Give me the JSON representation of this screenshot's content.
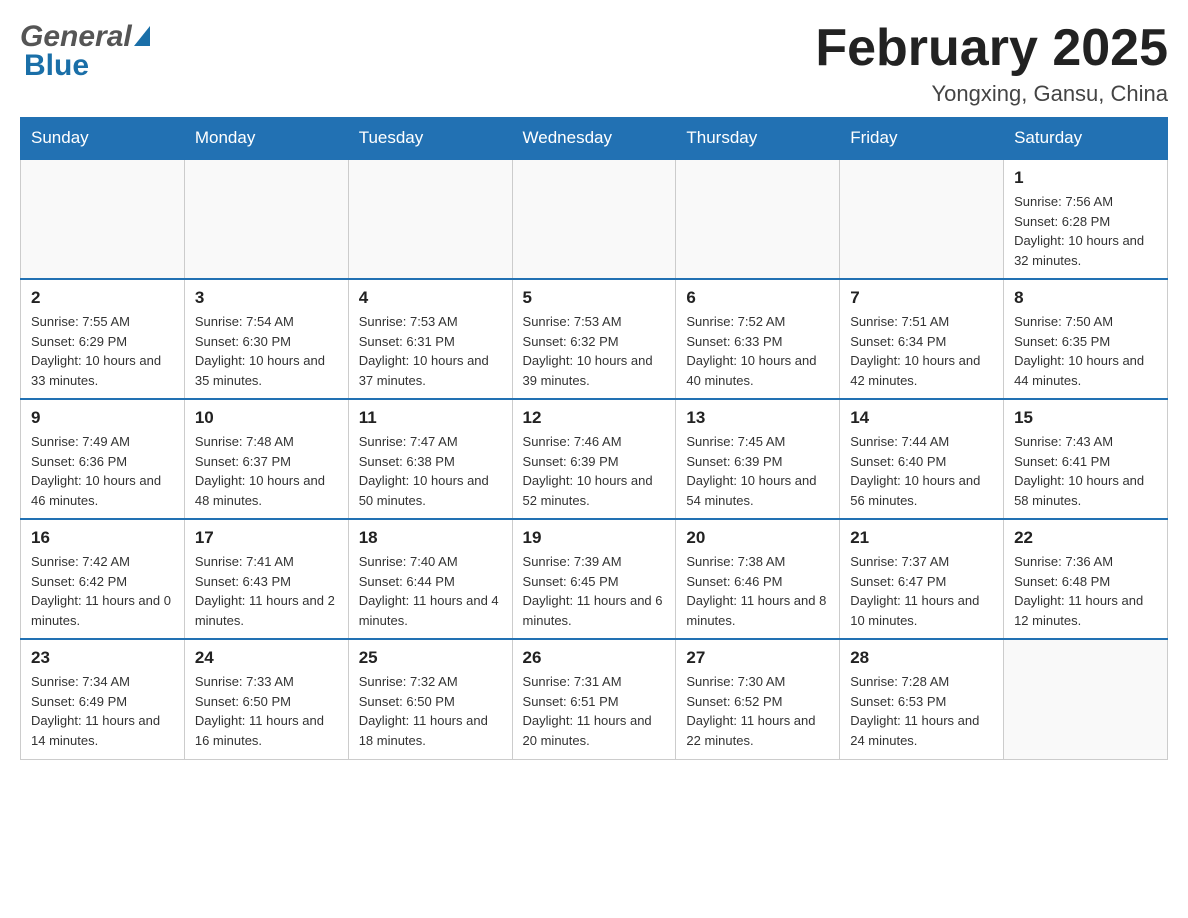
{
  "header": {
    "logo_line1": "General",
    "logo_line2": "Blue",
    "main_title": "February 2025",
    "subtitle": "Yongxing, Gansu, China"
  },
  "days_of_week": [
    "Sunday",
    "Monday",
    "Tuesday",
    "Wednesday",
    "Thursday",
    "Friday",
    "Saturday"
  ],
  "weeks": [
    [
      {
        "day": "",
        "info": ""
      },
      {
        "day": "",
        "info": ""
      },
      {
        "day": "",
        "info": ""
      },
      {
        "day": "",
        "info": ""
      },
      {
        "day": "",
        "info": ""
      },
      {
        "day": "",
        "info": ""
      },
      {
        "day": "1",
        "info": "Sunrise: 7:56 AM\nSunset: 6:28 PM\nDaylight: 10 hours and 32 minutes."
      }
    ],
    [
      {
        "day": "2",
        "info": "Sunrise: 7:55 AM\nSunset: 6:29 PM\nDaylight: 10 hours and 33 minutes."
      },
      {
        "day": "3",
        "info": "Sunrise: 7:54 AM\nSunset: 6:30 PM\nDaylight: 10 hours and 35 minutes."
      },
      {
        "day": "4",
        "info": "Sunrise: 7:53 AM\nSunset: 6:31 PM\nDaylight: 10 hours and 37 minutes."
      },
      {
        "day": "5",
        "info": "Sunrise: 7:53 AM\nSunset: 6:32 PM\nDaylight: 10 hours and 39 minutes."
      },
      {
        "day": "6",
        "info": "Sunrise: 7:52 AM\nSunset: 6:33 PM\nDaylight: 10 hours and 40 minutes."
      },
      {
        "day": "7",
        "info": "Sunrise: 7:51 AM\nSunset: 6:34 PM\nDaylight: 10 hours and 42 minutes."
      },
      {
        "day": "8",
        "info": "Sunrise: 7:50 AM\nSunset: 6:35 PM\nDaylight: 10 hours and 44 minutes."
      }
    ],
    [
      {
        "day": "9",
        "info": "Sunrise: 7:49 AM\nSunset: 6:36 PM\nDaylight: 10 hours and 46 minutes."
      },
      {
        "day": "10",
        "info": "Sunrise: 7:48 AM\nSunset: 6:37 PM\nDaylight: 10 hours and 48 minutes."
      },
      {
        "day": "11",
        "info": "Sunrise: 7:47 AM\nSunset: 6:38 PM\nDaylight: 10 hours and 50 minutes."
      },
      {
        "day": "12",
        "info": "Sunrise: 7:46 AM\nSunset: 6:39 PM\nDaylight: 10 hours and 52 minutes."
      },
      {
        "day": "13",
        "info": "Sunrise: 7:45 AM\nSunset: 6:39 PM\nDaylight: 10 hours and 54 minutes."
      },
      {
        "day": "14",
        "info": "Sunrise: 7:44 AM\nSunset: 6:40 PM\nDaylight: 10 hours and 56 minutes."
      },
      {
        "day": "15",
        "info": "Sunrise: 7:43 AM\nSunset: 6:41 PM\nDaylight: 10 hours and 58 minutes."
      }
    ],
    [
      {
        "day": "16",
        "info": "Sunrise: 7:42 AM\nSunset: 6:42 PM\nDaylight: 11 hours and 0 minutes."
      },
      {
        "day": "17",
        "info": "Sunrise: 7:41 AM\nSunset: 6:43 PM\nDaylight: 11 hours and 2 minutes."
      },
      {
        "day": "18",
        "info": "Sunrise: 7:40 AM\nSunset: 6:44 PM\nDaylight: 11 hours and 4 minutes."
      },
      {
        "day": "19",
        "info": "Sunrise: 7:39 AM\nSunset: 6:45 PM\nDaylight: 11 hours and 6 minutes."
      },
      {
        "day": "20",
        "info": "Sunrise: 7:38 AM\nSunset: 6:46 PM\nDaylight: 11 hours and 8 minutes."
      },
      {
        "day": "21",
        "info": "Sunrise: 7:37 AM\nSunset: 6:47 PM\nDaylight: 11 hours and 10 minutes."
      },
      {
        "day": "22",
        "info": "Sunrise: 7:36 AM\nSunset: 6:48 PM\nDaylight: 11 hours and 12 minutes."
      }
    ],
    [
      {
        "day": "23",
        "info": "Sunrise: 7:34 AM\nSunset: 6:49 PM\nDaylight: 11 hours and 14 minutes."
      },
      {
        "day": "24",
        "info": "Sunrise: 7:33 AM\nSunset: 6:50 PM\nDaylight: 11 hours and 16 minutes."
      },
      {
        "day": "25",
        "info": "Sunrise: 7:32 AM\nSunset: 6:50 PM\nDaylight: 11 hours and 18 minutes."
      },
      {
        "day": "26",
        "info": "Sunrise: 7:31 AM\nSunset: 6:51 PM\nDaylight: 11 hours and 20 minutes."
      },
      {
        "day": "27",
        "info": "Sunrise: 7:30 AM\nSunset: 6:52 PM\nDaylight: 11 hours and 22 minutes."
      },
      {
        "day": "28",
        "info": "Sunrise: 7:28 AM\nSunset: 6:53 PM\nDaylight: 11 hours and 24 minutes."
      },
      {
        "day": "",
        "info": ""
      }
    ]
  ]
}
